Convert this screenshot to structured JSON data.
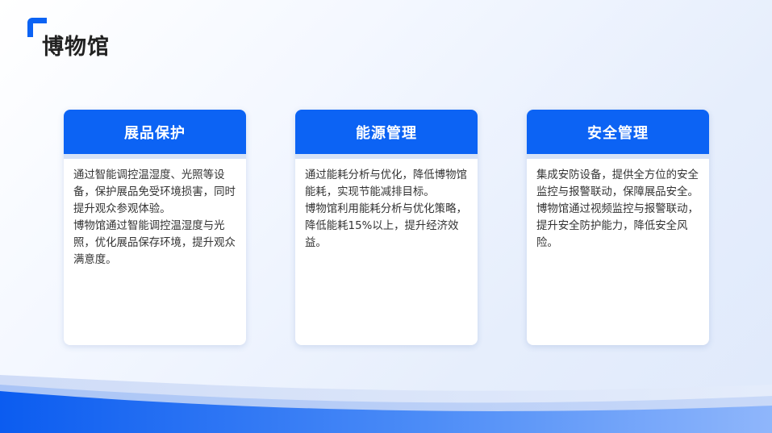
{
  "page": {
    "title": "博物馆"
  },
  "colors": {
    "accent": "#0c63f4",
    "title": "#222222",
    "body_text": "#333333"
  },
  "cards": [
    {
      "title": "展品保护",
      "paragraphs": [
        "通过智能调控温湿度、光照等设备，保护展品免受环境损害，同时提升观众参观体验。",
        "博物馆通过智能调控温湿度与光照，优化展品保存环境，提升观众满意度。"
      ]
    },
    {
      "title": "能源管理",
      "paragraphs": [
        "通过能耗分析与优化，降低博物馆能耗，实现节能减排目标。",
        "博物馆利用能耗分析与优化策略，降低能耗15%以上，提升经济效益。"
      ]
    },
    {
      "title": "安全管理",
      "paragraphs": [
        "集成安防设备，提供全方位的安全监控与报警联动，保障展品安全。",
        "博物馆通过视频监控与报警联动，提升安全防护能力，降低安全风险。"
      ]
    }
  ]
}
